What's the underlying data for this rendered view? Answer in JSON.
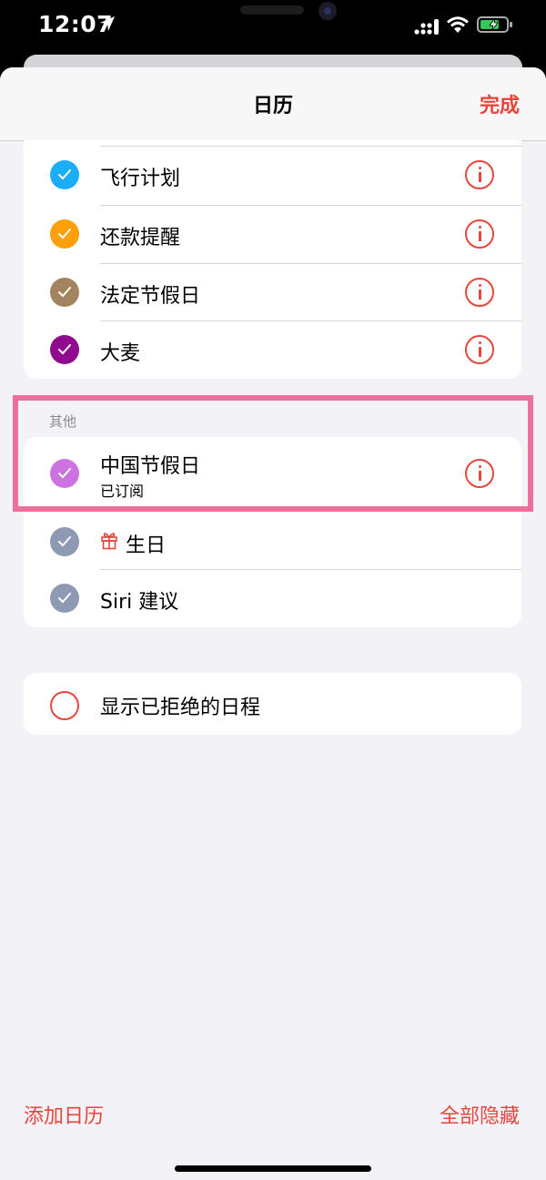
{
  "status_bar": {
    "time": "12:07"
  },
  "nav": {
    "title": "日历",
    "done_label": "完成"
  },
  "group1": {
    "items": [
      {
        "label": "飞行计划",
        "color": "#1badf8"
      },
      {
        "label": "还款提醒",
        "color": "#ff9f0a"
      },
      {
        "label": "法定节假日",
        "color": "#a2845e"
      },
      {
        "label": "大麦",
        "color": "#8e0b8e"
      }
    ]
  },
  "section_other": {
    "header": "其他",
    "items": [
      {
        "label": "中国节假日",
        "subtitle": "已订阅",
        "color": "#cc73e1"
      },
      {
        "label": "生日",
        "color": "#8e99b4",
        "icon": "gift-icon"
      },
      {
        "label": "Siri 建议",
        "color": "#8e99b4"
      }
    ]
  },
  "declined": {
    "label": "显示已拒绝的日程"
  },
  "bottom": {
    "add_calendar": "添加日历",
    "hide_all": "全部隐藏"
  },
  "colors": {
    "accent": "#e8453c",
    "highlight": "#ee6f99"
  }
}
